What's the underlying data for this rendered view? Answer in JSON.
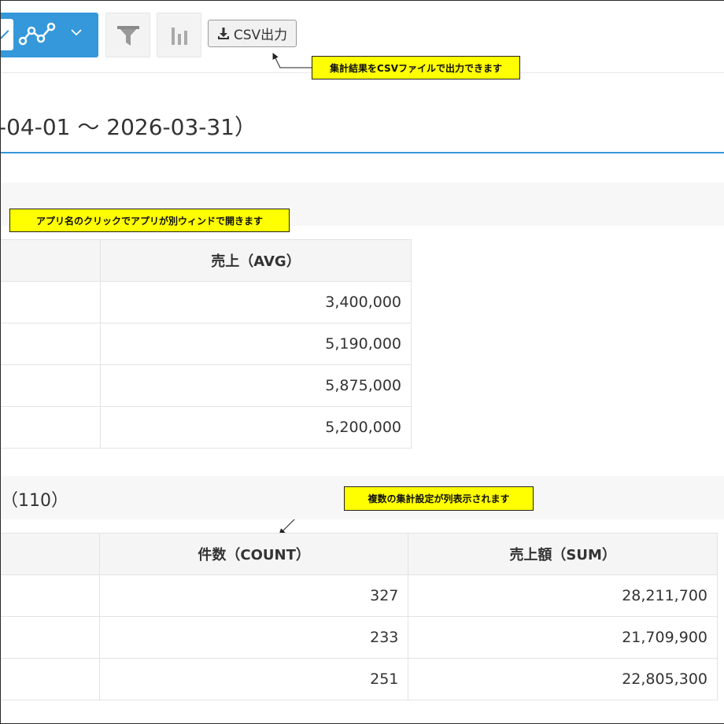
{
  "toolbar": {
    "graph_type_icon": "line-chart-icon",
    "dropdown_icon": "chevron-down-icon",
    "filter_icon": "funnel-icon",
    "chart_settings_icon": "bar-chart-icon",
    "csv_button_label": "CSV出力",
    "csv_icon": "download-icon",
    "accent_color": "#3498db"
  },
  "callouts": {
    "csv": "集計結果をCSVファイルで出力できます",
    "app_link": "アプリ名のクリックでアプリが別ウィンドで開きます",
    "multi_agg": "複数の集計設定が列表示されます"
  },
  "report": {
    "period": "-04-01 ～ 2026-03-31）"
  },
  "section2": {
    "label": "（110）"
  },
  "table1": {
    "header": "売上（AVG）",
    "rows": [
      "3,400,000",
      "5,190,000",
      "5,875,000",
      "5,200,000"
    ]
  },
  "table2": {
    "headers": [
      "件数（COUNT）",
      "売上額（SUM）"
    ],
    "rows": [
      {
        "count": "327",
        "sum": "28,211,700"
      },
      {
        "count": "233",
        "sum": "21,709,900"
      },
      {
        "count": "251",
        "sum": "22,805,300"
      }
    ]
  }
}
